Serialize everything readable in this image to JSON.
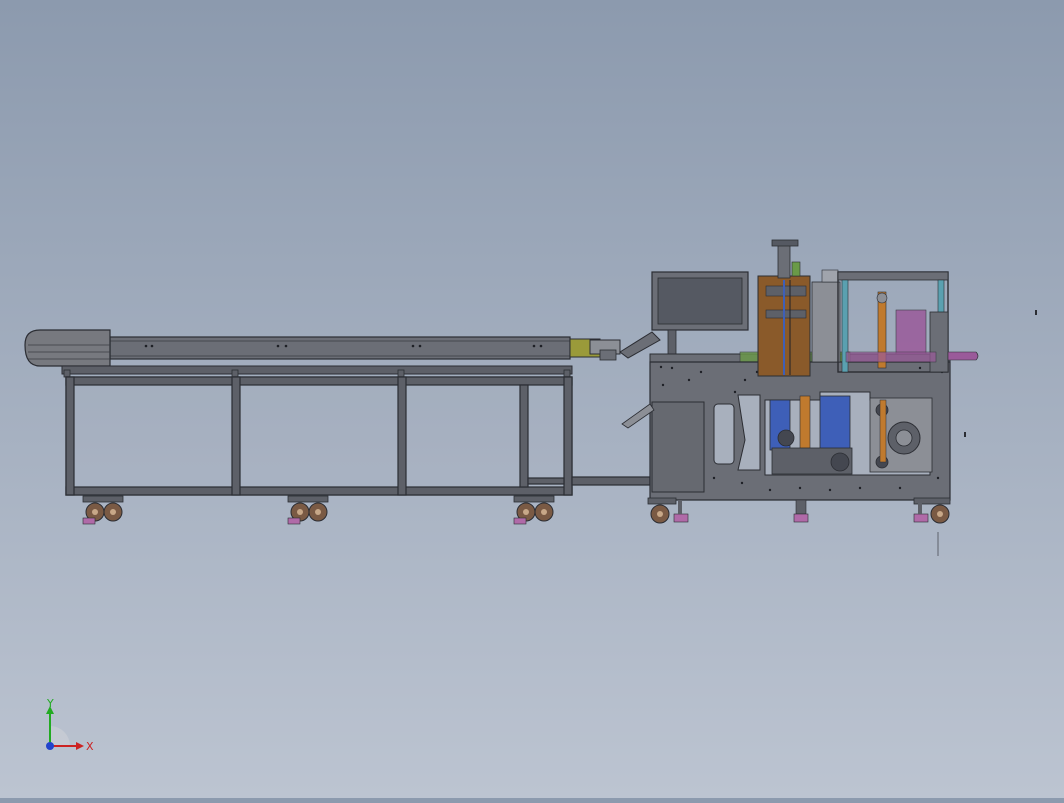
{
  "viewport": {
    "background_top": "#8c9aae",
    "background_bottom": "#bcc4d1"
  },
  "colors": {
    "frame": "#5d6068",
    "frame_edge": "#2b2d33",
    "panel": "#6b6e76",
    "screen": "#555962",
    "caster_wheel": "#7a5a44",
    "caster_foot": "#b06aa8",
    "brown_plate": "#8a5a2a",
    "orange": "#c07a2e",
    "blue": "#3e5fb8",
    "cyan": "#5aa0b0",
    "green": "#6a9a48",
    "purple": "#9a5a9a"
  },
  "triad": {
    "x_label": "X",
    "y_label": "Y",
    "x_color": "#cc2222",
    "y_color": "#22aa22",
    "z_color": "#2244cc",
    "icon": "coordinate-triad-icon"
  }
}
